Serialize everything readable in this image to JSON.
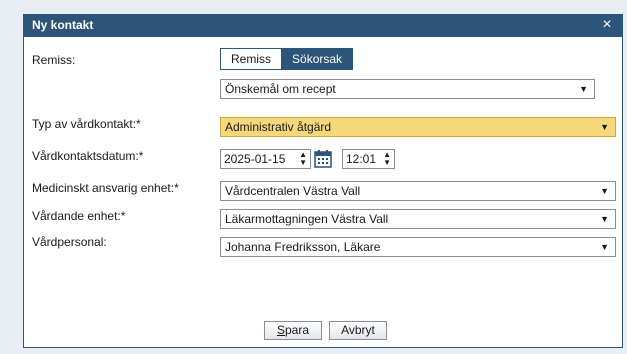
{
  "dialog": {
    "title": "Ny kontakt",
    "close_glyph": "×"
  },
  "remiss": {
    "label": "Remiss:",
    "options": [
      "Remiss",
      "Sökorsak"
    ],
    "selected": "Sökorsak",
    "reason_value": "Önskemål om recept"
  },
  "typ": {
    "label": "Typ av vårdkontakt:*",
    "value": "Administrativ åtgärd"
  },
  "datum": {
    "label": "Vårdkontaktsdatum:*",
    "date": "2025-01-15",
    "time": "12:01"
  },
  "medicinskt": {
    "label": "Medicinskt ansvarig enhet:*",
    "value": "Vårdcentralen Västra Vall"
  },
  "vardande": {
    "label": "Vårdande enhet:*",
    "value": "Läkarmottagningen Västra Vall"
  },
  "personal": {
    "label": "Vårdpersonal:",
    "value": "Johanna Fredriksson, Läkare"
  },
  "buttons": {
    "save_access": "S",
    "save_rest": "para",
    "cancel": "Avbryt"
  },
  "icons": {
    "dropdown": "chevron-down-icon",
    "spinner": "spinner-icon",
    "calendar": "calendar-icon",
    "close": "close-icon"
  },
  "colors": {
    "titlebar": "#2d5479",
    "highlight": "#f6d77a"
  }
}
